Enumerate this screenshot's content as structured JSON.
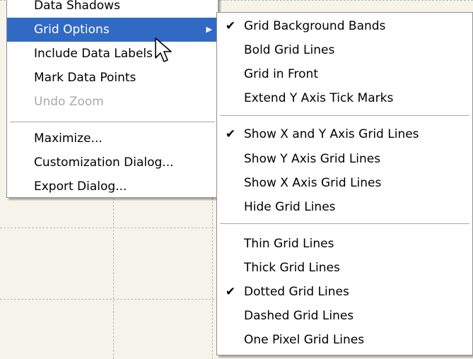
{
  "main_menu": {
    "items": [
      {
        "label": "Data Shadows",
        "state": "normal"
      },
      {
        "label": "Grid Options",
        "state": "highlighted",
        "submenu": true
      },
      {
        "label": "Include Data Labels",
        "state": "normal"
      },
      {
        "label": "Mark Data Points",
        "state": "normal"
      },
      {
        "label": "Undo Zoom",
        "state": "disabled"
      },
      {
        "label": "Maximize...",
        "state": "normal"
      },
      {
        "label": "Customization Dialog...",
        "state": "normal"
      },
      {
        "label": "Export Dialog...",
        "state": "normal"
      }
    ]
  },
  "submenu": {
    "items": [
      {
        "label": "Grid Background Bands",
        "checked": true
      },
      {
        "label": "Bold Grid Lines",
        "checked": false
      },
      {
        "label": "Grid in Front",
        "checked": false
      },
      {
        "label": "Extend Y Axis Tick Marks",
        "checked": false
      },
      {
        "label": "Show X and Y Axis Grid Lines",
        "checked": true
      },
      {
        "label": "Show Y Axis Grid Lines",
        "checked": false
      },
      {
        "label": "Show X Axis Grid Lines",
        "checked": false
      },
      {
        "label": "Hide Grid Lines",
        "checked": false
      },
      {
        "label": "Thin Grid Lines",
        "checked": false
      },
      {
        "label": "Thick Grid Lines",
        "checked": false
      },
      {
        "label": "Dotted Grid Lines",
        "checked": true
      },
      {
        "label": "Dashed Grid Lines",
        "checked": false
      },
      {
        "label": "One Pixel Grid Lines",
        "checked": false
      }
    ]
  },
  "icons": {
    "checkmark": "check-icon",
    "submenu_arrow": "submenu-arrow-icon",
    "cursor": "mouse-pointer-icon"
  },
  "colors": {
    "highlight": "#316ac5",
    "background": "#f6f4ea",
    "disabled_text": "#a9a9a9"
  }
}
